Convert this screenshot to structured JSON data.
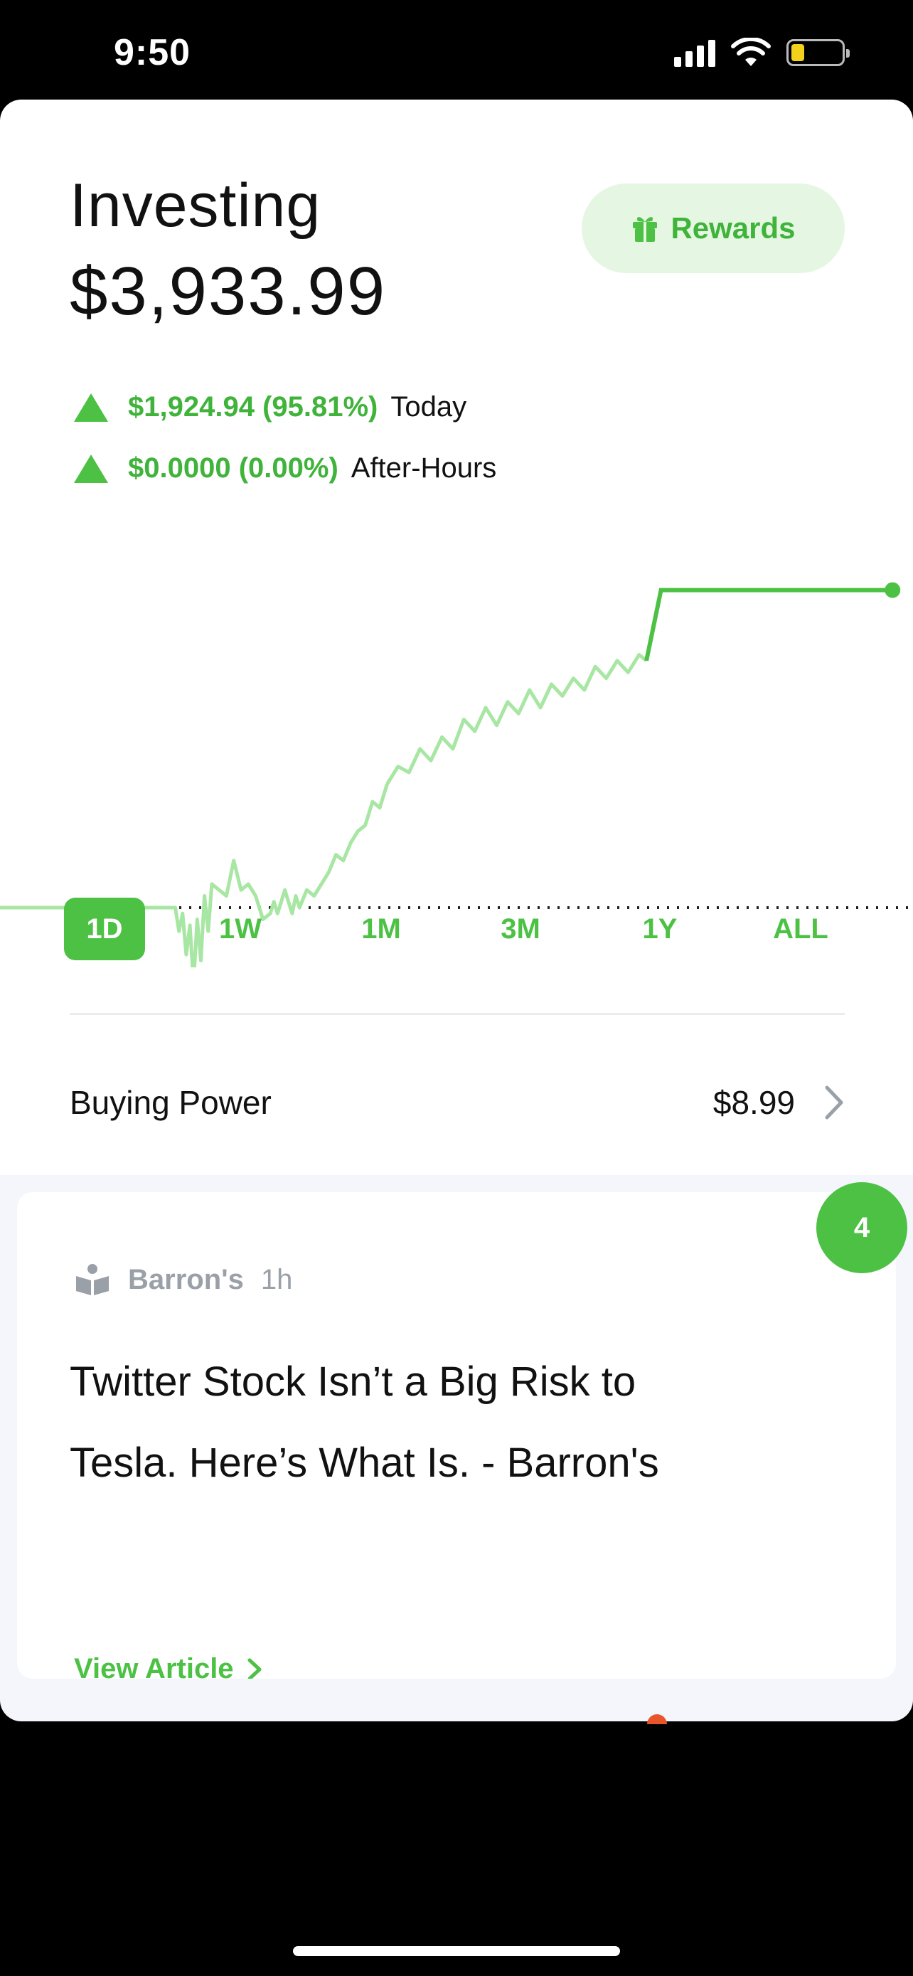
{
  "status_bar": {
    "time": "9:50"
  },
  "header": {
    "title": "Investing",
    "portfolio_value": "$3,933.99",
    "rewards_label": "Rewards"
  },
  "changes": {
    "today": {
      "value": "$1,924.94 (95.81%)",
      "label": "Today"
    },
    "after_hours": {
      "value": "$0.0000 (0.00%)",
      "label": "After-Hours"
    }
  },
  "colors": {
    "accent": "#4cc144",
    "accent_light": "#a8e6a3",
    "rewards_bg": "#e5f7e2"
  },
  "chart_data": {
    "type": "line",
    "x": [
      0,
      20,
      40,
      60,
      70,
      80,
      90,
      100,
      110,
      120,
      130,
      140,
      150,
      160,
      170,
      180,
      190,
      200,
      210,
      220,
      230,
      240,
      245,
      250,
      255,
      260,
      265,
      270,
      275,
      280,
      285,
      290,
      300,
      310,
      320,
      330,
      340,
      350,
      360,
      370,
      375,
      380,
      385,
      390,
      395,
      400,
      405,
      410,
      420,
      430,
      440,
      450,
      460,
      470,
      480,
      490,
      500,
      510,
      520,
      530
    ],
    "y": [
      100,
      100,
      100,
      100,
      100,
      100,
      100,
      100,
      100,
      100,
      100,
      100,
      100,
      100,
      100,
      100,
      100,
      100,
      100,
      100,
      100,
      100,
      96,
      99,
      92,
      97,
      87,
      98,
      91,
      102,
      96,
      104,
      103,
      102,
      108,
      103,
      104,
      102,
      98,
      99,
      101,
      99,
      101,
      103,
      101,
      99,
      102,
      100,
      103,
      102,
      104,
      106,
      109,
      108,
      111,
      113,
      114,
      118,
      117,
      121
    ],
    "x2": [
      530,
      545,
      560,
      575,
      590,
      605,
      620,
      635,
      650,
      665,
      680,
      695,
      710,
      725,
      740,
      755,
      770,
      785,
      800,
      815,
      830,
      845,
      860,
      875,
      885
    ],
    "y2": [
      121,
      124,
      123,
      127,
      125,
      129,
      127,
      132,
      130,
      134,
      131,
      135,
      133,
      137,
      134,
      138,
      136,
      139,
      137,
      141,
      139,
      142,
      140,
      143,
      142
    ],
    "flat_value": 154,
    "baseline": 100,
    "ylim": [
      85,
      160
    ]
  },
  "range_tabs": [
    "1D",
    "1W",
    "1M",
    "3M",
    "1Y",
    "ALL"
  ],
  "active_range": "1D",
  "buying_power": {
    "label": "Buying Power",
    "value": "$8.99"
  },
  "news": {
    "badge_count": "4",
    "source": "Barron's",
    "time": "1h",
    "headline_line1": "Twitter Stock Isn’t a Big Risk to",
    "headline_line2": "Tesla. Here’s What Is. - Barron's",
    "view_label": "View Article"
  }
}
